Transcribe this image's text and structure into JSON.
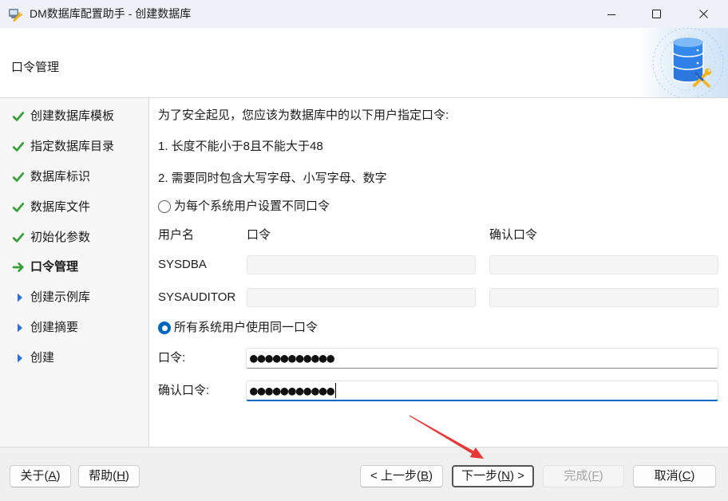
{
  "window": {
    "title": "DM数据库配置助手 - 创建数据库",
    "app_icon": "database-config-app-icon",
    "controls": [
      "minimize-icon",
      "maximize-icon",
      "close-icon"
    ]
  },
  "header": {
    "title": "口令管理",
    "banner_icon": "database-maintenance-icon"
  },
  "steps": [
    {
      "label": "创建数据库模板",
      "icon": "check-icon",
      "current": false
    },
    {
      "label": "指定数据库目录",
      "icon": "check-icon",
      "current": false
    },
    {
      "label": "数据库标识",
      "icon": "check-icon",
      "current": false
    },
    {
      "label": "数据库文件",
      "icon": "check-icon",
      "current": false
    },
    {
      "label": "初始化参数",
      "icon": "check-icon",
      "current": false
    },
    {
      "label": "口令管理",
      "icon": "arrow-right-icon",
      "current": true
    },
    {
      "label": "创建示例库",
      "icon": "triangle-right-icon",
      "current": false
    },
    {
      "label": "创建摘要",
      "icon": "triangle-right-icon",
      "current": false
    },
    {
      "label": "创建",
      "icon": "triangle-right-icon",
      "current": false
    }
  ],
  "content": {
    "intro": "为了安全起见，您应该为数据库中的以下用户指定口令:",
    "rules": [
      "1. 长度不能小于8且不能大于48",
      "2. 需要同时包含大写字母、小写字母、数字"
    ],
    "per_user_option": {
      "label": "为每个系统用户设置不同口令",
      "selected": false
    },
    "table_headers": {
      "username": "用户名",
      "password": "口令",
      "confirm": "确认口令"
    },
    "users": [
      {
        "name": "SYSDBA",
        "password": "",
        "confirm": "",
        "enabled": false
      },
      {
        "name": "SYSAUDITOR",
        "password": "",
        "confirm": "",
        "enabled": false
      }
    ],
    "shared_option": {
      "label": "所有系统用户使用同一口令",
      "selected": true
    },
    "shared_password": {
      "label": "口令:",
      "value": "●●●●●●●●●●●",
      "focused": false
    },
    "shared_confirm": {
      "label": "确认口令:",
      "value": "●●●●●●●●●●●",
      "focused": true
    }
  },
  "footer": {
    "about": {
      "label": "关于(A)",
      "enabled": true
    },
    "help": {
      "label": "帮助(H)",
      "enabled": true
    },
    "back": {
      "label": "< 上一步(B)",
      "enabled": true
    },
    "next": {
      "label": "下一步(N) >",
      "enabled": true
    },
    "finish": {
      "label": "完成(F)",
      "enabled": false
    },
    "cancel": {
      "label": "取消(C)",
      "enabled": true
    }
  },
  "annotation": {
    "icon": "red-arrow-annotation",
    "color": "#e53935"
  },
  "colors": {
    "accent": "#0067c0",
    "done_green": "#35a035",
    "pending_blue": "#2d6fd6",
    "footer_bg": "#f0f0f0"
  }
}
